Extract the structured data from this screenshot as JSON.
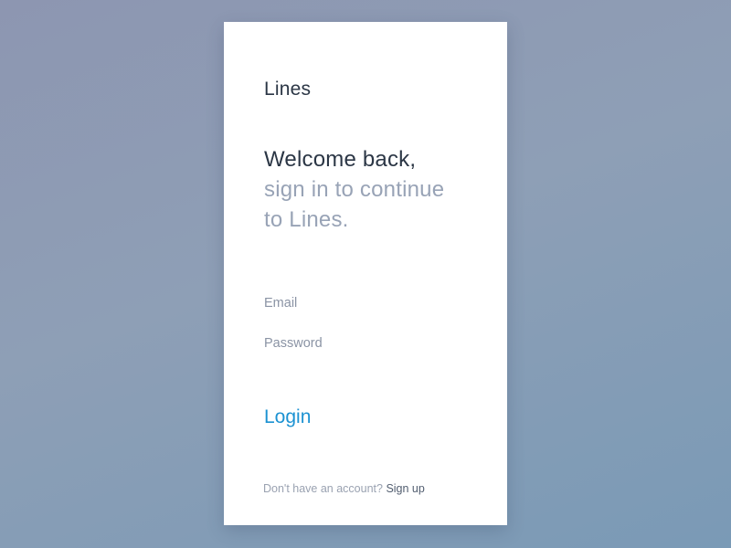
{
  "app": {
    "brand": "Lines"
  },
  "headline": {
    "line1": "Welcome back,",
    "line2": "sign in to continue",
    "line3": "to Lines."
  },
  "form": {
    "email": {
      "placeholder": "Email",
      "value": ""
    },
    "password": {
      "placeholder": "Password",
      "value": ""
    },
    "login_label": "Login"
  },
  "footer": {
    "prompt": "Don't have an account?",
    "signup_label": "Sign up"
  },
  "colors": {
    "background": "#8e9fb6",
    "card": "#ffffff",
    "primary_text": "#2b3645",
    "muted_text": "#98a3b6",
    "accent": "#1c92d2"
  }
}
